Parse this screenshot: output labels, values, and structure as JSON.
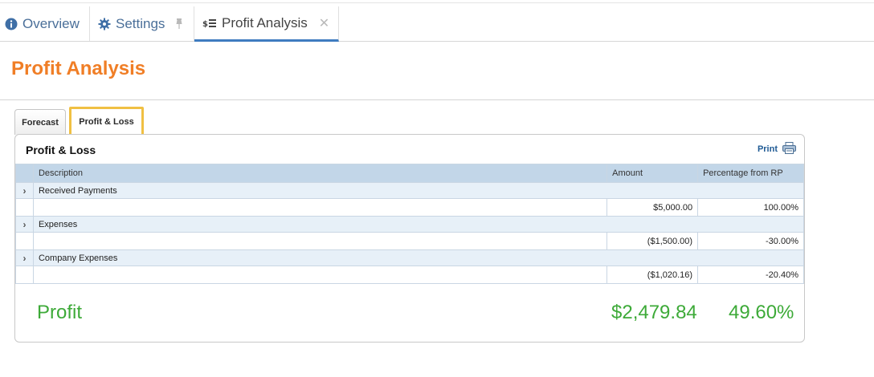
{
  "tabs": [
    {
      "label": "Overview",
      "icon": "info-circle-icon"
    },
    {
      "label": "Settings",
      "icon": "gear-icon",
      "pinned": true
    },
    {
      "label": "Profit Analysis",
      "icon": "dollar-list-icon",
      "active": true,
      "closable": true
    }
  ],
  "page": {
    "title": "Profit Analysis"
  },
  "subtabs": [
    {
      "label": "Forecast"
    },
    {
      "label": "Profit & Loss",
      "focused": true
    }
  ],
  "panel": {
    "title": "Profit & Loss",
    "print_label": "Print",
    "columns": [
      "Description",
      "Amount",
      "Percentage from RP"
    ],
    "rows": [
      {
        "description": "Received Payments",
        "amount": "$5,000.00",
        "percentage": "100.00%"
      },
      {
        "description": "Expenses",
        "amount": "($1,500.00)",
        "percentage": "-30.00%"
      },
      {
        "description": "Company Expenses",
        "amount": "($1,020.16)",
        "percentage": "-20.40%"
      }
    ],
    "profit": {
      "label": "Profit",
      "amount": "$2,479.84",
      "percentage": "49.60%"
    }
  },
  "colors": {
    "accent_orange": "#f07e26",
    "profit_green": "#3daa38",
    "tab_blue": "#3f7cc0",
    "focus_yellow": "#f0c043"
  }
}
